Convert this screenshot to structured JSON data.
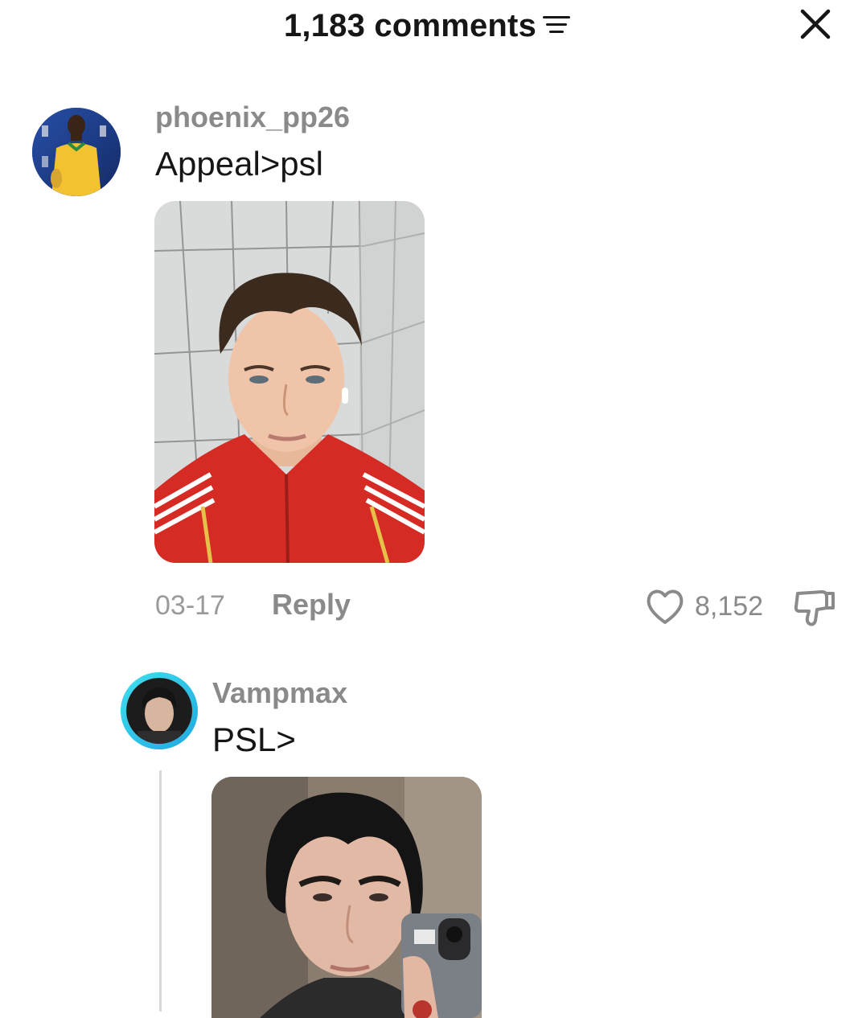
{
  "header": {
    "title": "1,183 comments",
    "sort_icon": "sort-lines-icon",
    "close_icon": "close-icon"
  },
  "comments": [
    {
      "username": "phoenix_pp26",
      "text": "Appeal>psl",
      "date": "03-17",
      "reply_label": "Reply",
      "likes": "8,152",
      "avatar_icon": "avatar-soccer-player",
      "photo_desc_icon": "photo-selfie-red-jacket"
    }
  ],
  "replies": [
    {
      "username": "Vampmax",
      "text": "PSL>",
      "avatar_ring_color": "#2fc6e8",
      "photo_desc_icon": "photo-selfie-mirror-phone"
    }
  ],
  "colors": {
    "text_primary": "#161616",
    "text_secondary": "#8a8a8a",
    "story_ring": "#2fc6e8"
  }
}
